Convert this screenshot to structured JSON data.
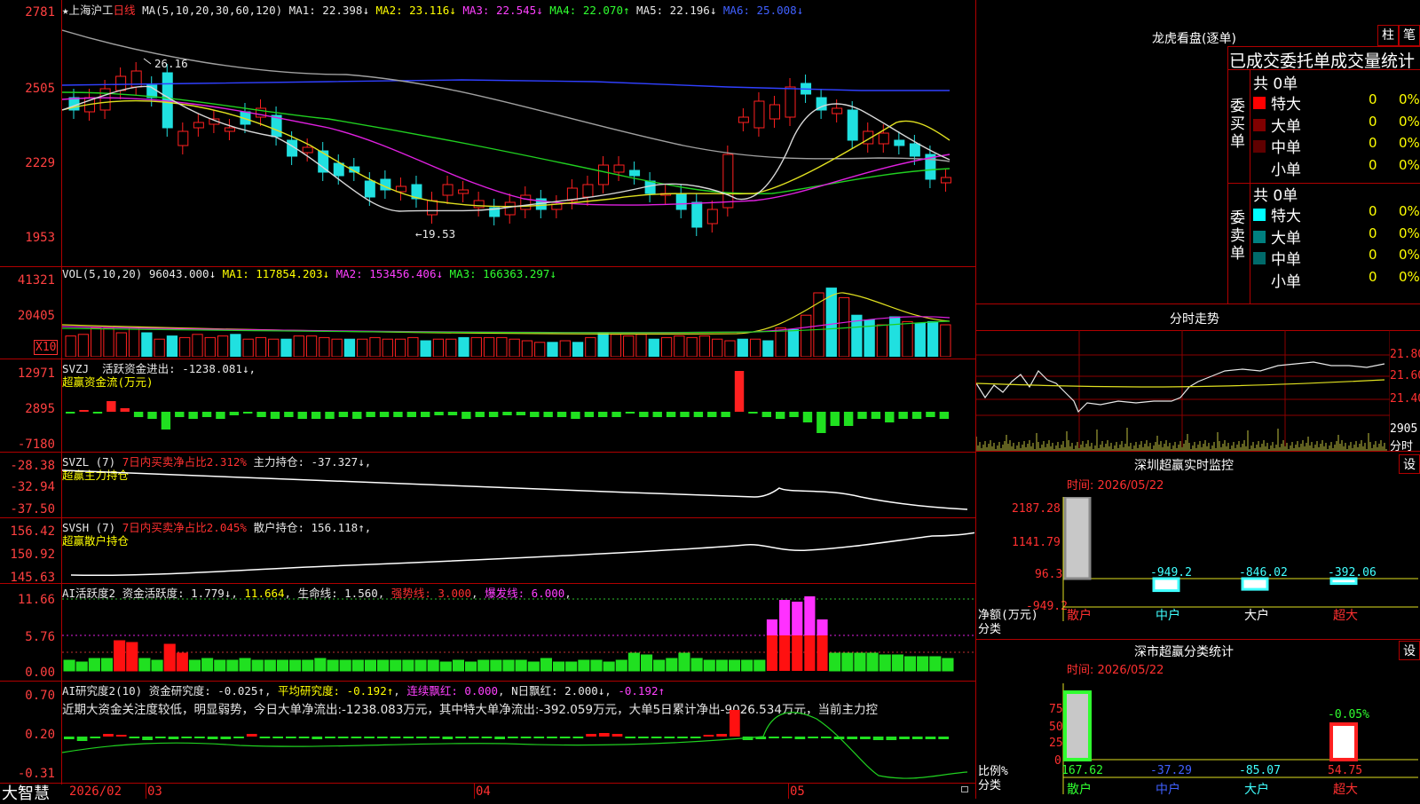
{
  "main": {
    "header": {
      "star": "★",
      "name": "上海沪工",
      "period": "日线",
      "ma_title": "MA(5,10,20,30,60,120)",
      "ma1": "MA1: 22.398↓",
      "ma2": "MA2: 23.116↓",
      "ma3": "MA3: 22.545↓",
      "ma4": "MA4: 22.070↑",
      "ma5": "MA5: 22.196↓",
      "ma6": "MA6: 25.008↓"
    },
    "y_labels": [
      "2781",
      "2505",
      "2229",
      "1953"
    ],
    "high_note": "26.16",
    "low_note": "←19.53"
  },
  "vol": {
    "title": "VOL(5,10,20)",
    "val": "96043.000↓",
    "ma1": "MA1: 117854.203↓",
    "ma2": "MA2: 153456.406↓",
    "ma3": "MA3: 166363.297↓",
    "y_labels": [
      "41321",
      "20405"
    ],
    "unit": "X10"
  },
  "svzj": {
    "title": "SVZJ",
    "line1": "活跃资金进出: -1238.081↓,",
    "line2": "超赢资金流(万元)",
    "y_labels": [
      "12971",
      "2895",
      "-7180"
    ]
  },
  "svzl": {
    "title": "SVZL (7)",
    "red": "7日内买卖净占比2.312%",
    "white": "主力持仓: -37.327↓,",
    "line2": "超赢主力持仓",
    "y_labels": [
      "-28.38",
      "-32.94",
      "-37.50"
    ]
  },
  "svsh": {
    "title": "SVSH (7)",
    "red": "7日内买卖净占比2.045%",
    "white": "散户持仓: 156.118↑,",
    "line2": "超赢散户持仓",
    "y_labels": [
      "156.42",
      "150.92",
      "145.63"
    ]
  },
  "ai_active": {
    "title": "AI活跃度2",
    "v1": "资金活跃度: 1.779↓",
    "v2": "11.664",
    "v3": "生命线: 1.560",
    "v4": "强势线: 3.000",
    "v5": "爆发线: 6.000",
    "y_labels": [
      "11.66",
      "5.76",
      "0.00"
    ]
  },
  "ai_research": {
    "title": "AI研究度2(10)",
    "v1": "资金研究度: -0.025↑",
    "v2": "平均研究度: -0.192↑",
    "v3": "连续飘红: 0.000",
    "v4": "N日飘红: 2.000↓",
    "v5": "-0.192↑",
    "comment": "近期大资金关注度较低，明显弱势，今日大单净流出:-1238.083万元，其中特大单净流出:-392.059万元，大单5日累计净出-9026.534万元，当前主力控",
    "y_labels": [
      "0.70",
      "0.20",
      "-0.31"
    ]
  },
  "x_axis": {
    "brand": "大智慧",
    "labels": [
      "2026/02",
      "03",
      "04",
      "05"
    ]
  },
  "right": {
    "lhb": {
      "title": "龙虎看盘(逐单)",
      "btn1": "柱",
      "btn2": "笔",
      "tabs": "已成交委托单成交量统计",
      "buy_label": "委买单",
      "sell_label": "委卖单",
      "buy_total": "共 0单",
      "sell_total": "共 0单",
      "buy_rows": [
        {
          "name": "特大",
          "count": "0",
          "pct": "0%",
          "color": "#ff0000"
        },
        {
          "name": "大单",
          "count": "0",
          "pct": "0%",
          "color": "#800000"
        },
        {
          "name": "中单",
          "count": "0",
          "pct": "0%",
          "color": "#600000"
        },
        {
          "name": "小单",
          "count": "0",
          "pct": "0%",
          "color": "#000000"
        }
      ],
      "sell_rows": [
        {
          "name": "特大",
          "count": "0",
          "pct": "0%",
          "color": "#00ffff"
        },
        {
          "name": "大单",
          "count": "0",
          "pct": "0%",
          "color": "#008080"
        },
        {
          "name": "中单",
          "count": "0",
          "pct": "0%",
          "color": "#006a6a"
        },
        {
          "name": "小单",
          "count": "0",
          "pct": "0%",
          "color": "#000000"
        }
      ]
    },
    "fenshi": {
      "title": "分时走势",
      "y_labels": [
        "21.80",
        "21.60",
        "21.40"
      ],
      "vol_label": "2905",
      "vol_unit": "分时"
    },
    "monitor": {
      "title": "深圳超赢实时监控",
      "btn": "设",
      "time": "时间: 2026/05/22",
      "y_labels": [
        "2187.28",
        "1141.79",
        "96.3",
        "-949.2"
      ],
      "y_unit": "净额(万元)",
      "x_unit": "分类",
      "bars": [
        {
          "name": "散户",
          "value": 2187.28,
          "label": "2187.28"
        },
        {
          "name": "中户",
          "value": -949.2,
          "label": "-949.2"
        },
        {
          "name": "大户",
          "value": -846.02,
          "label": "-846.02"
        },
        {
          "name": "超大",
          "value": -392.06,
          "label": "-392.06"
        }
      ]
    },
    "classify": {
      "title": "深市超赢分类统计",
      "btn": "设",
      "time": "时间: 2026/05/22",
      "y_labels": [
        "75",
        "50",
        "25",
        "0"
      ],
      "y_unit": "比例%",
      "x_unit": "分类",
      "top_label": "-0.05%",
      "bars": [
        {
          "name": "散户",
          "value": 167.62,
          "label": "167.62"
        },
        {
          "name": "中户",
          "value": -37.29,
          "label": "-37.29"
        },
        {
          "name": "大户",
          "value": -85.07,
          "label": "-85.07"
        },
        {
          "name": "超大",
          "value": 54.75,
          "label": "54.75"
        }
      ]
    }
  }
}
